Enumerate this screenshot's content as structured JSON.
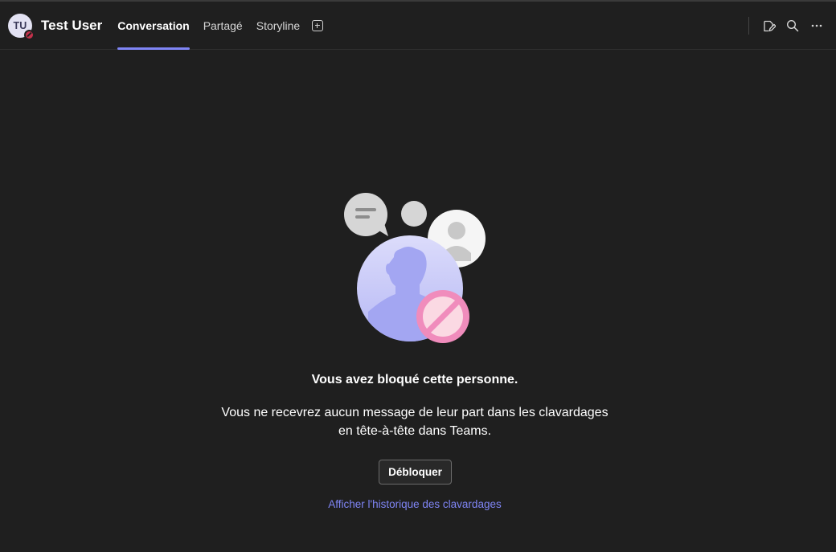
{
  "header": {
    "avatar_initials": "TU",
    "user_name": "Test User",
    "status": "blocked",
    "tabs": [
      {
        "label": "Conversation",
        "active": true
      },
      {
        "label": "Partagé",
        "active": false
      },
      {
        "label": "Storyline",
        "active": false
      }
    ],
    "icons": [
      "add-tab-icon",
      "compose-icon",
      "search-icon",
      "more-options-icon"
    ]
  },
  "main": {
    "title": "Vous avez bloqué cette personne.",
    "description_line1": "Vous ne recevrez aucun message de leur part dans les clavardages",
    "description_line2": "en tête-à-tête dans Teams.",
    "unblock_label": "Débloquer",
    "history_link": "Afficher l'historique des clavardages"
  },
  "colors": {
    "background": "#1f1f1f",
    "accent": "#7f85f5",
    "blocked_status": "#c4314b",
    "block_badge": "#f08cbc"
  }
}
